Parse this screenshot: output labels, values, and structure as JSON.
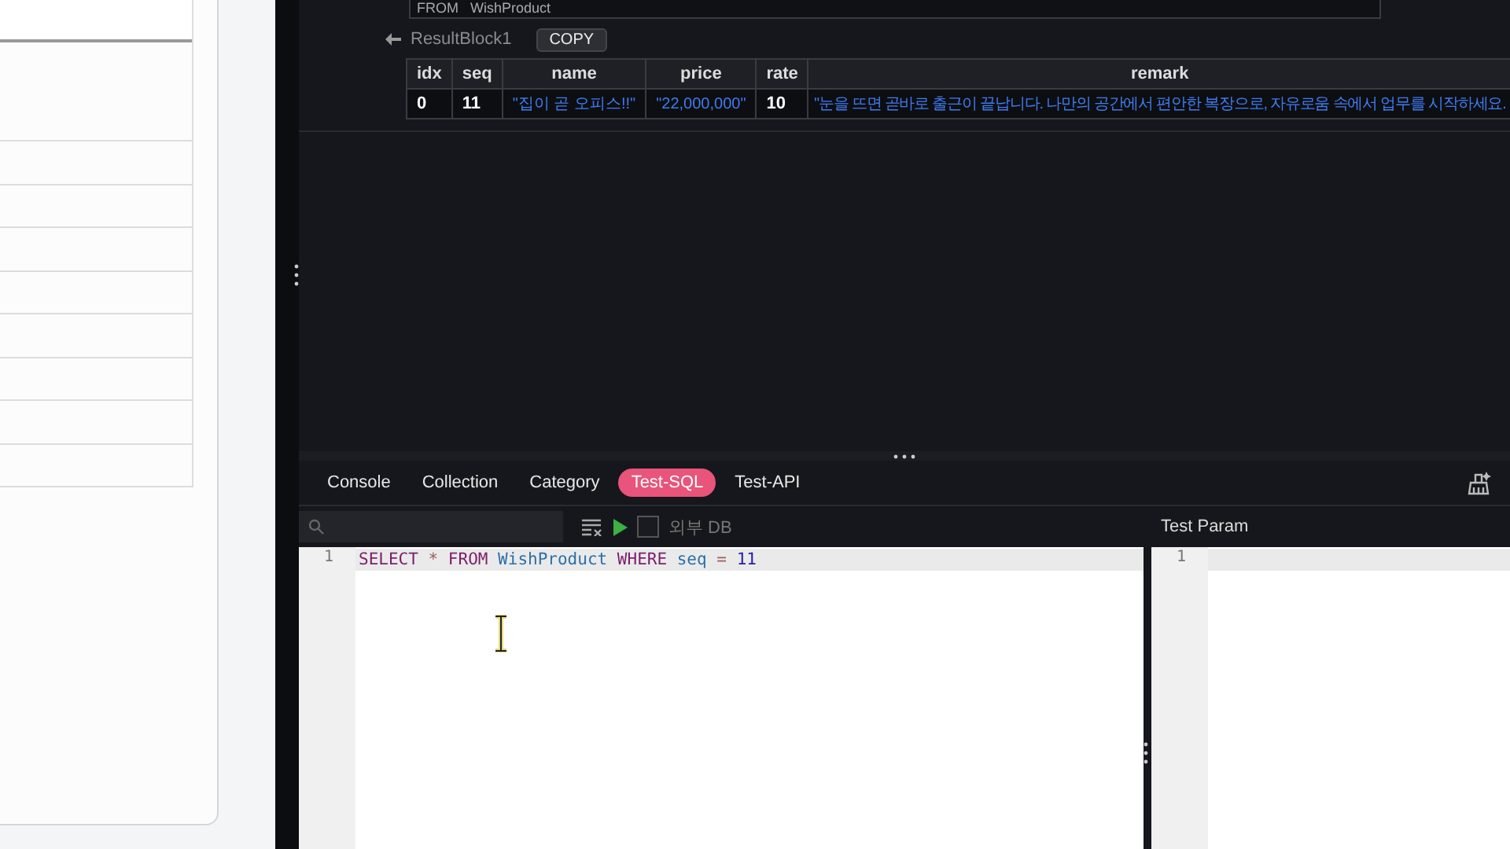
{
  "query_preview": {
    "text": "FROM   WishProduct"
  },
  "result_block": {
    "title": "ResultBlock1",
    "copy_button": "COPY",
    "columns": [
      "idx",
      "seq",
      "name",
      "price",
      "rate",
      "remark"
    ],
    "rows": [
      [
        "0",
        "11",
        "\"집이 곧 오피스!!\"",
        "\"22,000,000\"",
        "10",
        "\"눈을 뜨면 곧바로 출근이 끝납니다. 나만의 공간에서 편안한 복장으로, 자유로움 속에서 업무를 시작하세요."
      ]
    ]
  },
  "tabs": [
    {
      "label": "Console",
      "selected": false
    },
    {
      "label": "Collection",
      "selected": false
    },
    {
      "label": "Category",
      "selected": false
    },
    {
      "label": "Test-SQL",
      "selected": true
    },
    {
      "label": "Test-API",
      "selected": false
    }
  ],
  "editor": {
    "external_db": {
      "label": "외부 DB",
      "checked": false
    },
    "lines": [
      {
        "number": "1",
        "tokens": [
          {
            "text": "SELECT",
            "kind": "keyword"
          },
          {
            "text": "*",
            "kind": "operator"
          },
          {
            "text": "FROM",
            "kind": "keyword"
          },
          {
            "text": "WishProduct",
            "kind": "identifier"
          },
          {
            "text": "WHERE",
            "kind": "keyword"
          },
          {
            "text": "seq",
            "kind": "identifier"
          },
          {
            "text": "=",
            "kind": "operator"
          },
          {
            "text": "11",
            "kind": "number"
          }
        ]
      }
    ]
  },
  "test_param": {
    "title": "Test Param",
    "lines": [
      "1"
    ]
  }
}
